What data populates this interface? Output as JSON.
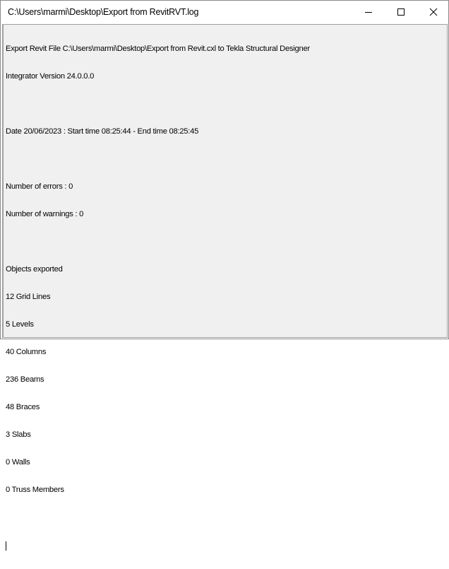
{
  "window": {
    "title": "C:\\Users\\marmi\\Desktop\\Export from RevitRVT.log",
    "controls": [
      "minimize-icon",
      "maximize-icon",
      "close-icon"
    ]
  },
  "log": {
    "header": "Export Revit File C:\\Users\\marmi\\Desktop\\Export from Revit.cxl to Tekla Structural Designer",
    "version": "Integrator Version 24.0.0.0",
    "date": "Date 20/06/2023 : Start time 08:25:44 - End time 08:25:45",
    "errors": "Number of errors : 0",
    "warnings": "Number of warnings : 0",
    "objects_heading": "Objects exported",
    "objects": [
      "12 Grid Lines",
      "5 Levels",
      "40 Columns",
      "236 Beams",
      "48 Braces",
      "3 Slabs",
      "0 Walls",
      "0 Truss Members"
    ]
  }
}
